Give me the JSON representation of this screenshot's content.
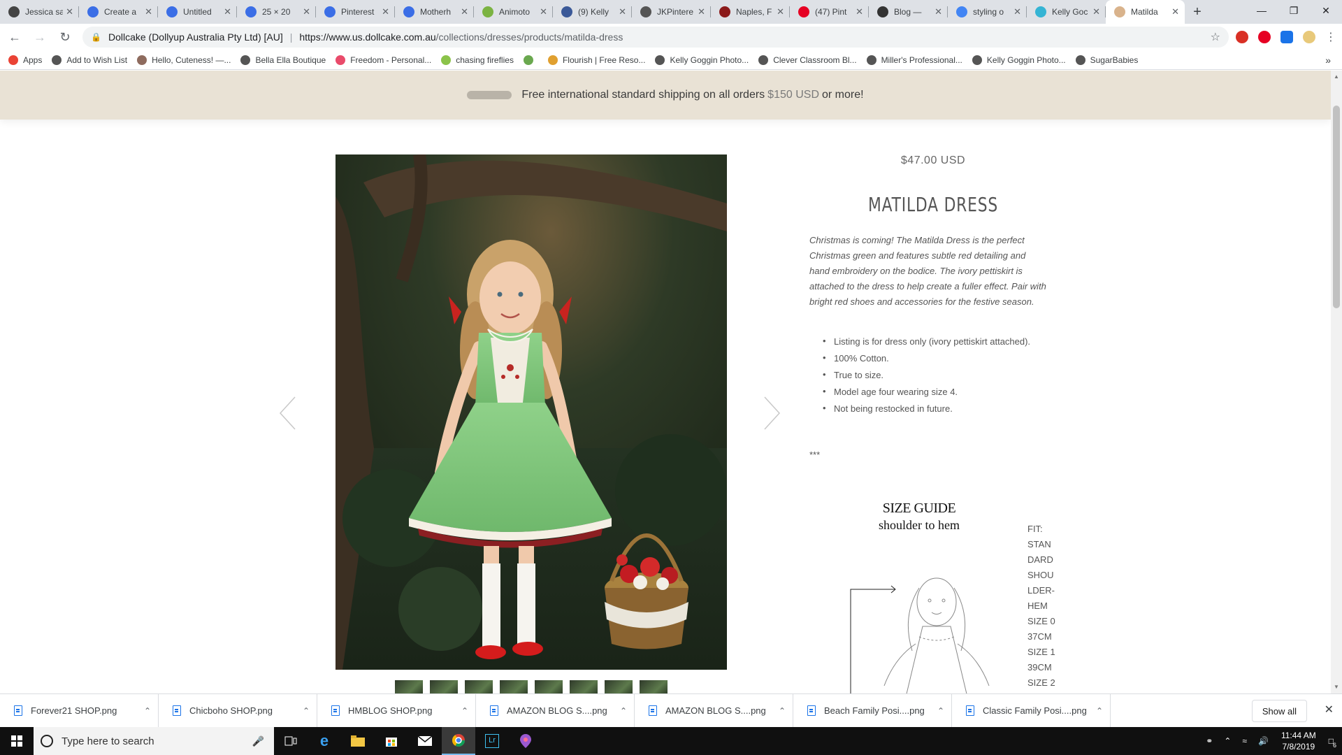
{
  "browser": {
    "tabs": [
      {
        "title": "Jessica sa",
        "color": "#444"
      },
      {
        "title": "Create a",
        "color": "#3b6ee6"
      },
      {
        "title": "Untitled",
        "color": "#3b6ee6"
      },
      {
        "title": "25 × 20",
        "color": "#3b6ee6"
      },
      {
        "title": "Pinterest",
        "color": "#3b6ee6"
      },
      {
        "title": "Motherh",
        "color": "#3b6ee6"
      },
      {
        "title": "Animoto",
        "color": "#7bb342"
      },
      {
        "title": "(9) Kelly",
        "color": "#3b5998"
      },
      {
        "title": "JKPintere",
        "color": "#555"
      },
      {
        "title": "Naples, F",
        "color": "#8b1a1a"
      },
      {
        "title": "(47) Pint",
        "color": "#e60023"
      },
      {
        "title": "Blog —",
        "color": "#333"
      },
      {
        "title": "styling o",
        "color": "#4285f4"
      },
      {
        "title": "Kelly Goc",
        "color": "#35b4d4"
      },
      {
        "title": "Matilda",
        "color": "#d9b38c"
      }
    ],
    "active_tab_index": 14,
    "site_identity": "Dollcake (Dollyup Australia Pty Ltd) [AU]",
    "url_domain": "https://www.us.dollcake.com.au",
    "url_path": "/collections/dresses/products/matilda-dress",
    "bookmarks": [
      {
        "label": "Apps",
        "color": "#ea4335"
      },
      {
        "label": "Add to Wish List",
        "color": "#555"
      },
      {
        "label": "Hello, Cuteness! —...",
        "color": "#8e6b5e"
      },
      {
        "label": "Bella Ella Boutique",
        "color": "#555"
      },
      {
        "label": "Freedom - Personal...",
        "color": "#e94b6b"
      },
      {
        "label": "chasing fireflies",
        "color": "#8bc34a"
      },
      {
        "label": "",
        "color": "#6aa84f"
      },
      {
        "label": "Flourish | Free Reso...",
        "color": "#e0a030"
      },
      {
        "label": "Kelly Goggin Photo...",
        "color": "#555"
      },
      {
        "label": "Clever Classroom Bl...",
        "color": "#555"
      },
      {
        "label": "Miller's Professional...",
        "color": "#555"
      },
      {
        "label": "Kelly Goggin Photo...",
        "color": "#555"
      },
      {
        "label": "SugarBabies",
        "color": "#555"
      }
    ]
  },
  "page": {
    "announcement": {
      "prefix": "Free international standard shipping on all orders",
      "amount": "$150 USD",
      "suffix": "or more!"
    },
    "product": {
      "price": "$47.00 USD",
      "title": "MATILDA DRESS",
      "description": "Christmas is coming! The Matilda Dress is the perfect Christmas green and features subtle red detailing and hand embroidery on the bodice. The ivory pettiskirt is attached to the dress to help create a fuller effect. Pair with bright red shoes and accessories for the festive season.",
      "bullets": [
        "Listing is for dress only (ivory pettiskirt attached).",
        "100% Cotton.",
        "True to size.",
        "Model age four wearing size 4.",
        "Not being restocked in future."
      ],
      "separator": "***",
      "thumbnail_count": 8
    },
    "size_guide": {
      "heading": "SIZE GUIDE",
      "subheading": "shoulder to hem",
      "fit_lines": [
        "FIT:",
        "STAN",
        "DARD",
        "SHOU",
        "LDER-",
        "HEM",
        "SIZE 0",
        "37CM",
        "SIZE 1",
        "39CM",
        "SIZE 2"
      ]
    }
  },
  "downloads": {
    "items": [
      "Forever21 SHOP.png",
      "Chicboho SHOP.png",
      "HMBLOG SHOP.png",
      "AMAZON BLOG S....png",
      "AMAZON BLOG S....png",
      "Beach Family Posi....png",
      "Classic Family Posi....png"
    ],
    "show_all": "Show all"
  },
  "taskbar": {
    "search_placeholder": "Type here to search",
    "time": "11:44 AM",
    "date": "7/8/2019",
    "notifications": "6"
  }
}
